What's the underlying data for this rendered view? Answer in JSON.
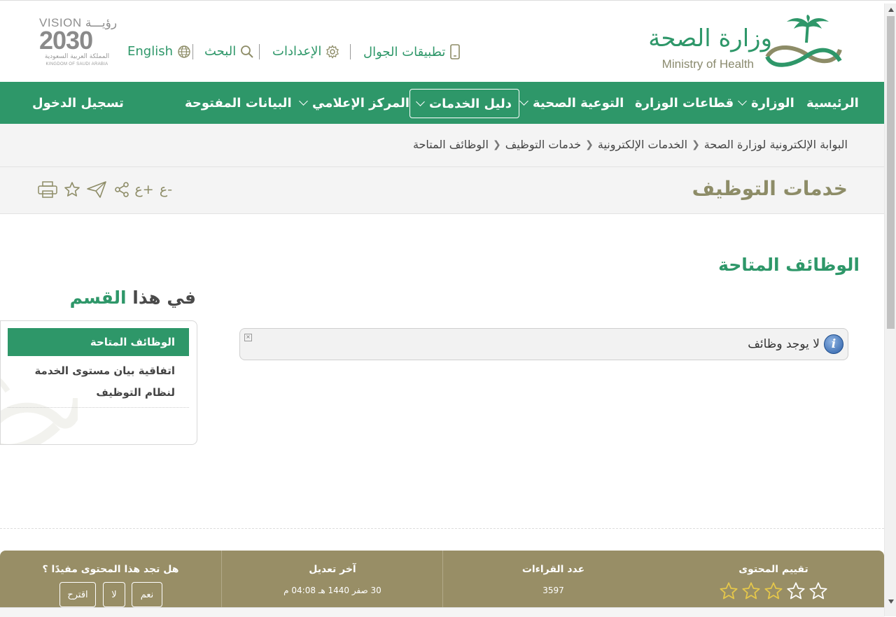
{
  "header": {
    "logo_ar": "وزارة الصحة",
    "logo_en": "Ministry of Health",
    "mobile_apps": "تطبيقات الجوال",
    "settings": "الإعدادات",
    "search": "البحث",
    "language": "English",
    "vision_word": "VISION رؤيـــة",
    "vision_year": "2030",
    "vision_kingdom_ar": "المملكة العربية السعودية",
    "vision_kingdom_en": "KINGDOM OF SAUDI ARABIA"
  },
  "nav": {
    "home": "الرئيسية",
    "ministry": "الوزارة",
    "sectors": "قطاعات الوزارة",
    "awareness": "التوعية الصحية",
    "services": "دليل الخدمات",
    "media": "المركز الإعلامي",
    "open_data": "البيانات المفتوحة",
    "login": "تسجيل الدخول"
  },
  "breadcrumb": {
    "items": [
      "البوابة الإلكترونية لوزارة الصحة",
      "الخدمات الإلكترونية",
      "خدمات التوظيف",
      "الوظائف المتاحة"
    ]
  },
  "page": {
    "title": "خدمات التوظيف",
    "section_title": "الوظائف المتاحة",
    "alert_text": "لا يوجد وظائف",
    "alert_icon_glyph": "i",
    "alert_close_glyph": "×"
  },
  "tools": {
    "font_decrease": "ع-",
    "font_increase": "ع+"
  },
  "side": {
    "title_a": "في هذا",
    "title_b": "القسم",
    "active_item": "الوظائف المتاحة",
    "link_item": "اتفاقية بيان مستوى الخدمة لنظام التوظيف"
  },
  "footer": {
    "rating_label": "تقييم المحتوى",
    "rating_stars": 5,
    "reads_label": "عدد القراءات",
    "reads_value": "3597",
    "modified_label": "آخر تعديل",
    "modified_value": "30 صفر 1440 هـ 04:08 م",
    "useful_label": "هل تجد هذا المحتوى مفيدًا ؟",
    "yes": "نعم",
    "no": "لا",
    "suggest": "اقترح"
  },
  "colors": {
    "green": "#2e9769",
    "olive": "#8d8c67",
    "footer": "#988e66"
  }
}
